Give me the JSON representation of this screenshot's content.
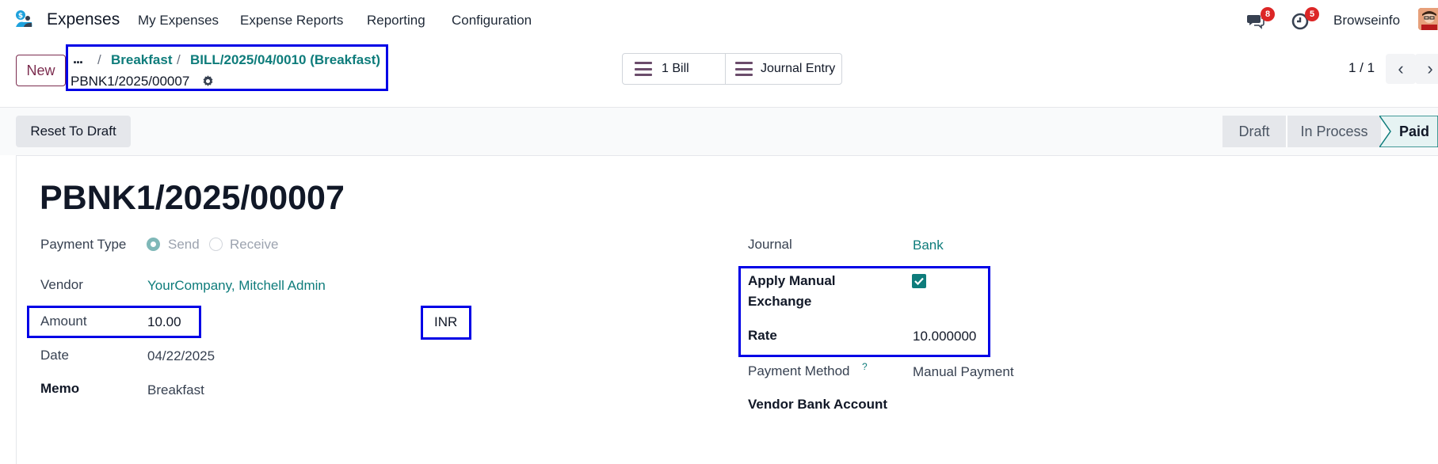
{
  "navbar": {
    "app_name": "Expenses",
    "menu": [
      "My Expenses",
      "Expense Reports",
      "Reporting",
      "Configuration"
    ],
    "messages_badge": "8",
    "activities_badge": "5",
    "user_name": "Browseinfo"
  },
  "control_panel": {
    "new_label": "New",
    "breadcrumb_dots": "...",
    "breadcrumb_sep": "/",
    "breadcrumb": [
      "Breakfast",
      "BILL/2025/04/0010 (Breakfast)"
    ],
    "current_record": "PBNK1/2025/00007",
    "smart_buttons": [
      "1 Bill",
      "Journal Entry"
    ],
    "pager": "1 / 1"
  },
  "status": {
    "reset_label": "Reset To Draft",
    "steps": [
      "Draft",
      "In Process",
      "Paid"
    ],
    "active_step": "Paid"
  },
  "form": {
    "title": "PBNK1/2025/00007",
    "payment_type_label": "Payment Type",
    "payment_type_options": [
      "Send",
      "Receive"
    ],
    "payment_type_selected": "Send",
    "vendor_label": "Vendor",
    "vendor_value": "YourCompany, Mitchell Admin",
    "amount_label": "Amount",
    "amount_value": "10.00",
    "currency": "INR",
    "date_label": "Date",
    "date_value": "04/22/2025",
    "memo_label": "Memo",
    "memo_value": "Breakfast",
    "journal_label": "Journal",
    "journal_value": "Bank",
    "apply_manual_label_1": "Apply Manual",
    "apply_manual_label_2": "Exchange",
    "apply_manual_checked": true,
    "rate_label": "Rate",
    "rate_value": "10.000000",
    "payment_method_label": "Payment Method",
    "payment_method_help": "?",
    "payment_method_value": "Manual Payment",
    "vendor_bank_label": "Vendor Bank Account"
  },
  "colors": {
    "accent": "#0e7c7b",
    "brand": "#7c2d4f",
    "highlight": "#0000e6",
    "badge": "#dc2626"
  }
}
